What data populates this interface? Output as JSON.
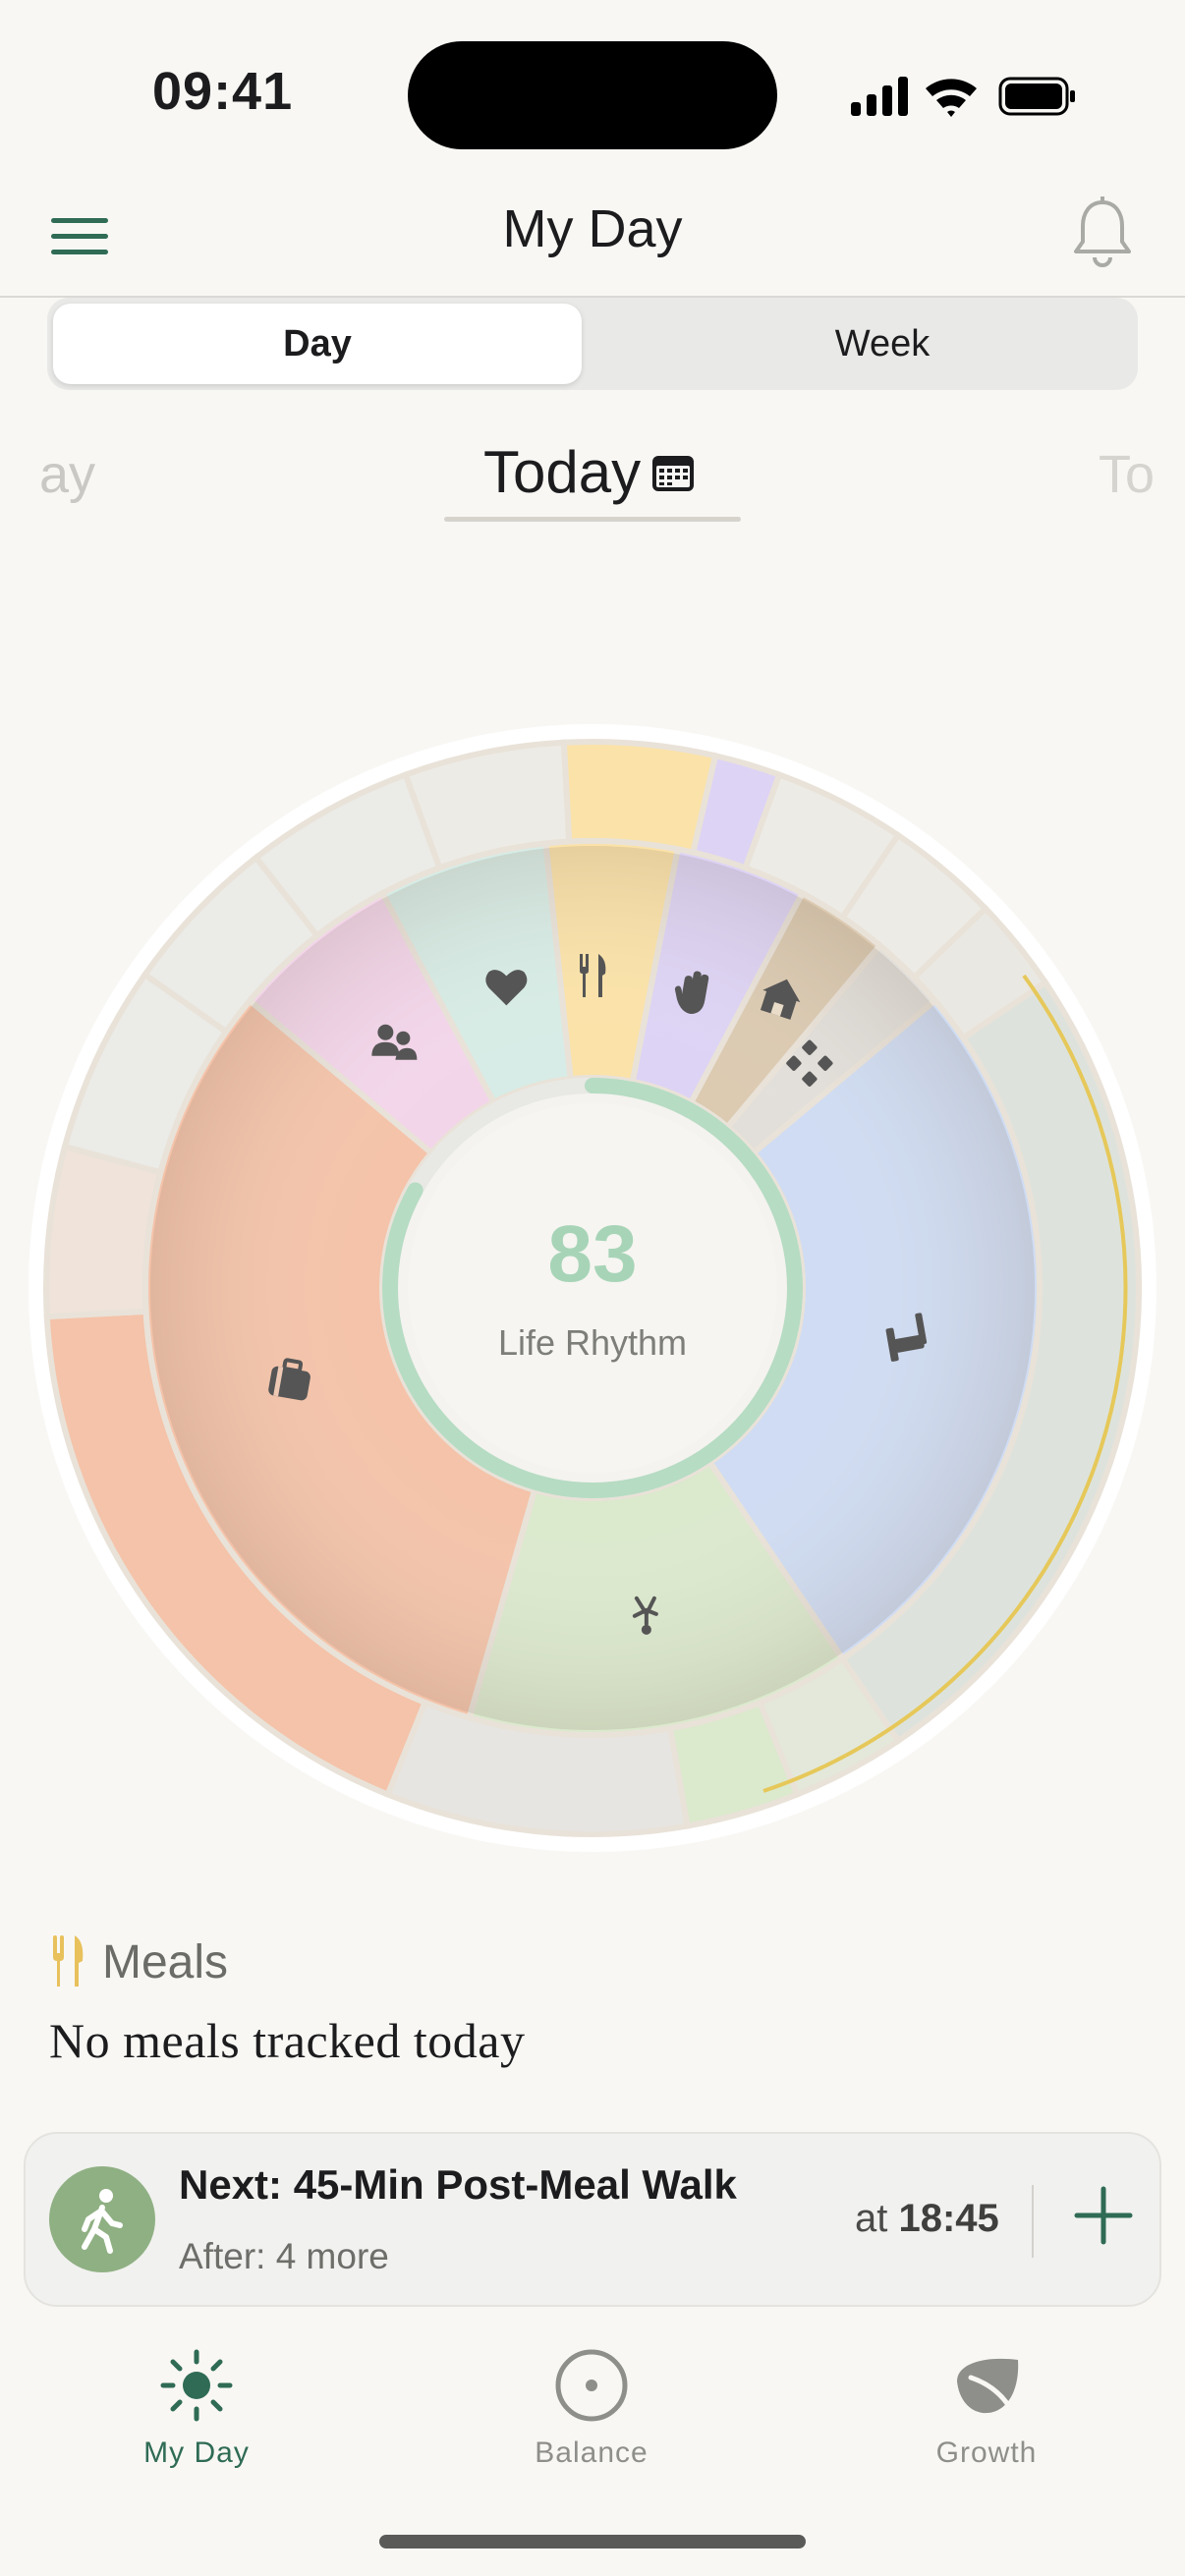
{
  "status_bar": {
    "time": "09:41"
  },
  "header": {
    "title": "My Day",
    "menu_icon": "hamburger-icon",
    "bell_icon": "bell-icon"
  },
  "segmented": {
    "day": "Day",
    "week": "Week",
    "selected": "Day"
  },
  "date_selector": {
    "prev": "ay",
    "current": "Today",
    "next": "To"
  },
  "wheel": {
    "score": "83",
    "score_label": "Life Rhythm",
    "score_ring_fraction": 0.83,
    "segments": [
      {
        "name": "work",
        "icon": "briefcase-icon",
        "color": "#f4c3a9"
      },
      {
        "name": "social",
        "icon": "people-icon",
        "color": "#f3d5ea"
      },
      {
        "name": "self-care",
        "icon": "heart-icon",
        "color": "#d7ece6"
      },
      {
        "name": "meals",
        "icon": "fork-knife-icon",
        "color": "#fbe2a8"
      },
      {
        "name": "mindfulness",
        "icon": "hand-icon",
        "color": "#ddd3f5"
      },
      {
        "name": "home",
        "icon": "house-icon",
        "color": "#dccab1"
      },
      {
        "name": "other",
        "icon": "grid-icon",
        "color": "#e2dfda"
      },
      {
        "name": "sleep",
        "icon": "bed-icon",
        "color": "#cfdcf3"
      },
      {
        "name": "exercise",
        "icon": "stretch-icon",
        "color": "#dbe9cd"
      }
    ]
  },
  "meals": {
    "title": "Meals",
    "empty_text": "No meals tracked today",
    "icon": "fork-knife-icon"
  },
  "next_activity": {
    "title": "Next: 45-Min Post-Meal Walk",
    "subtitle": "After: 4 more",
    "time_prefix": "at",
    "time": "18:45",
    "icon": "walking-icon"
  },
  "tab_bar": [
    {
      "label": "My Day",
      "icon": "sun-icon",
      "active": true
    },
    {
      "label": "Balance",
      "icon": "target-icon",
      "active": false
    },
    {
      "label": "Growth",
      "icon": "leaf-icon",
      "active": false
    }
  ],
  "colors": {
    "accent": "#2f6b55",
    "score": "#a7d4b7",
    "meals_gold": "#e8c15c"
  }
}
